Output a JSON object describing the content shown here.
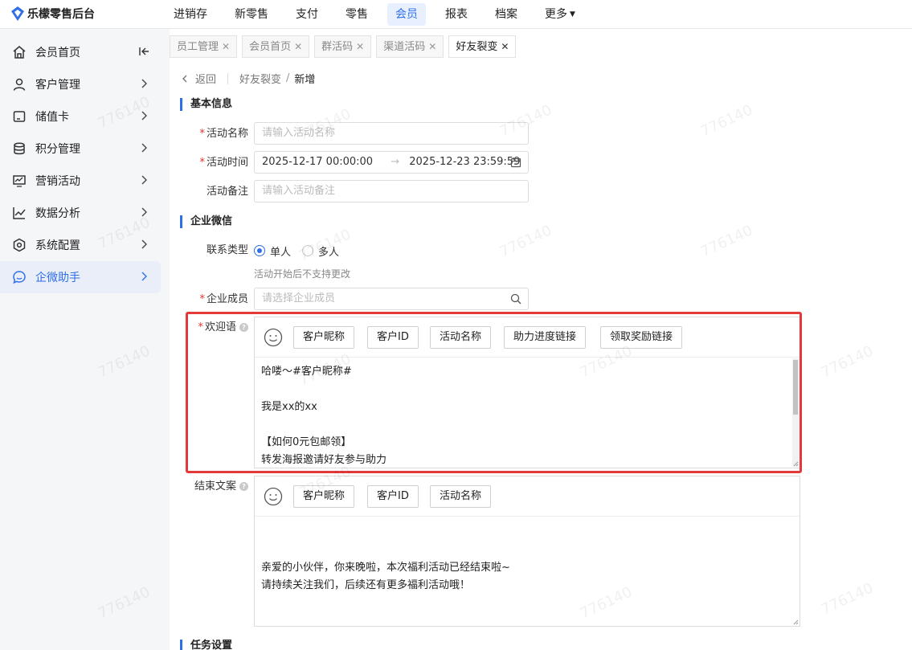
{
  "app": {
    "title": "乐檬零售后台"
  },
  "topnav": [
    {
      "label": "进销存"
    },
    {
      "label": "新零售"
    },
    {
      "label": "支付"
    },
    {
      "label": "零售"
    },
    {
      "label": "会员"
    },
    {
      "label": "报表"
    },
    {
      "label": "档案"
    },
    {
      "label": "更多"
    }
  ],
  "sidebar": {
    "items": [
      {
        "label": "会员首页",
        "icon": "home-icon",
        "trailing": "collapse-icon"
      },
      {
        "label": "客户管理",
        "icon": "user-icon",
        "trailing": "chevron-right-icon"
      },
      {
        "label": "储值卡",
        "icon": "card-icon",
        "trailing": "chevron-right-icon"
      },
      {
        "label": "积分管理",
        "icon": "database-icon",
        "trailing": "chevron-right-icon"
      },
      {
        "label": "营销活动",
        "icon": "monitor-icon",
        "trailing": "chevron-right-icon"
      },
      {
        "label": "数据分析",
        "icon": "chart-icon",
        "trailing": "chevron-right-icon"
      },
      {
        "label": "系统配置",
        "icon": "hexagon-icon",
        "trailing": "chevron-right-icon"
      },
      {
        "label": "企微助手",
        "icon": "chat-icon",
        "trailing": "chevron-right-icon",
        "active": true
      }
    ]
  },
  "tabs": [
    {
      "label": "员工管理"
    },
    {
      "label": "会员首页"
    },
    {
      "label": "群活码"
    },
    {
      "label": "渠道活码"
    },
    {
      "label": "好友裂变",
      "active": true
    }
  ],
  "breadcrumb": {
    "back": "返回",
    "parent": "好友裂变",
    "sep": "/",
    "current": "新增"
  },
  "sections": {
    "basic": "基本信息",
    "wecom": "企业微信",
    "task": "任务设置"
  },
  "form": {
    "name_label": "活动名称",
    "name_placeholder": "请输入活动名称",
    "time_label": "活动时间",
    "time_start": "2025-12-17 00:00:00",
    "time_arrow": "→",
    "time_end": "2025-12-23 23:59:59",
    "remark_label": "活动备注",
    "remark_placeholder": "请输入活动备注",
    "contact_label": "联系类型",
    "contact_single": "单人",
    "contact_multi": "多人",
    "contact_hint": "活动开始后不支持更改",
    "member_label": "企业成员",
    "member_placeholder": "请选择企业成员",
    "welcome_label": "欢迎语",
    "end_label": "结束文案"
  },
  "welcome": {
    "chips": [
      "客户昵称",
      "客户ID",
      "活动名称",
      "助力进度链接",
      "领取奖励链接"
    ],
    "lines": [
      "哈喽～#客户昵称#",
      "",
      "我是xx的xx",
      "",
      "【如何0元包邮领】",
      "转发海报邀请好友参与助力"
    ]
  },
  "ending": {
    "chips": [
      "客户昵称",
      "客户ID",
      "活动名称"
    ],
    "lines": [
      "",
      "",
      "亲爱的小伙伴，你来晚啦，本次福利活动已经结束啦~",
      "请持续关注我们，后续还有更多福利活动哦！"
    ]
  },
  "watermark": "776140",
  "colors": {
    "accent": "#2f6fe8",
    "highlight": "#e23a3a",
    "required": "#e5322d"
  }
}
